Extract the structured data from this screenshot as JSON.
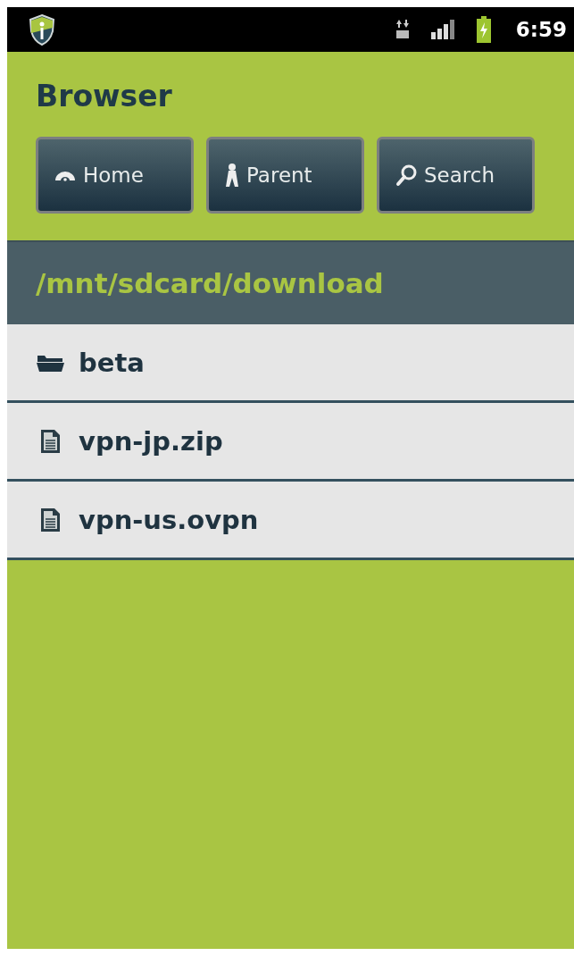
{
  "status_bar": {
    "time": "6:59"
  },
  "title": "Browser",
  "buttons": [
    {
      "label": "Home",
      "kind": "home"
    },
    {
      "label": "Parent",
      "kind": "parent"
    },
    {
      "label": "Search",
      "kind": "search"
    }
  ],
  "path": "/mnt/sdcard/download",
  "entries": [
    {
      "name": "beta",
      "kind": "folder"
    },
    {
      "name": "vpn-jp.zip",
      "kind": "file"
    },
    {
      "name": "vpn-us.ovpn",
      "kind": "file"
    }
  ]
}
